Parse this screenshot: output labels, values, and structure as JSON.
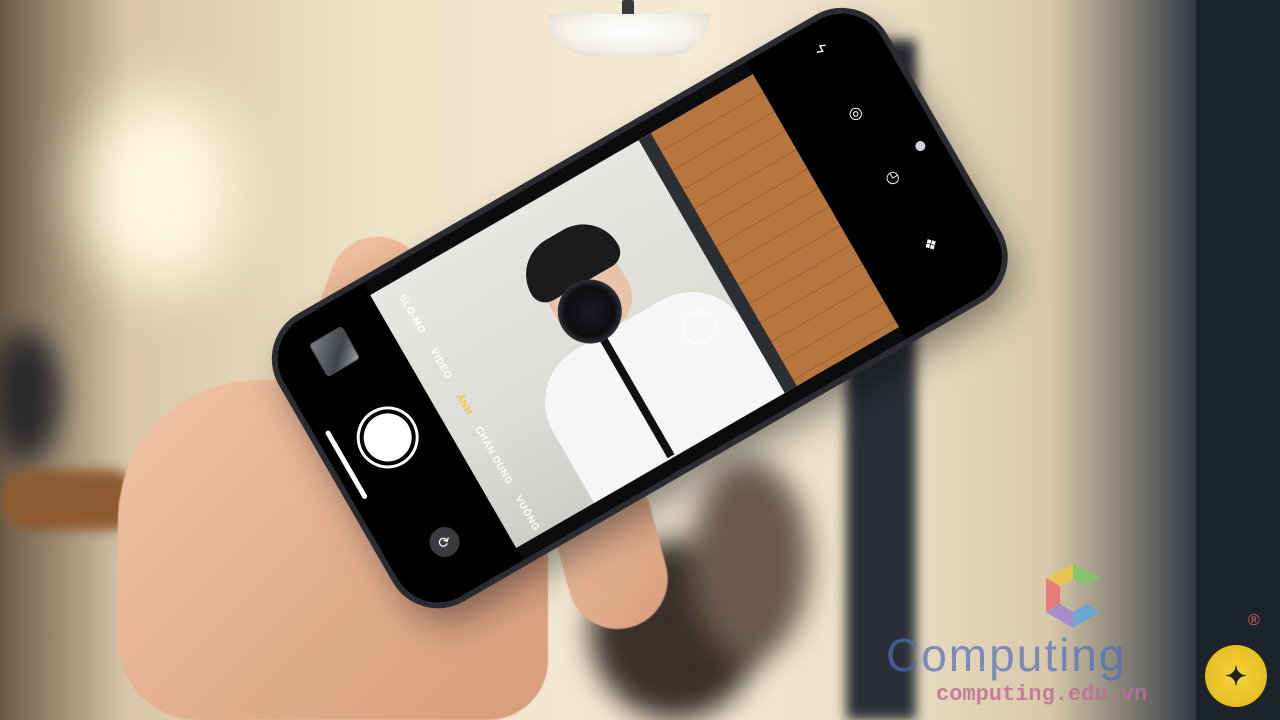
{
  "camera_app": {
    "modes": [
      {
        "label": "SLO-MO",
        "active": false
      },
      {
        "label": "VIDEO",
        "active": false
      },
      {
        "label": "ẢNH",
        "active": true
      },
      {
        "label": "CHÂN DUNG",
        "active": false
      },
      {
        "label": "VUÔNG",
        "active": false
      }
    ],
    "controls": {
      "flash_icon": "flash-icon",
      "live_photo_icon": "live-photo-icon",
      "timer_icon": "timer-icon",
      "filter_icon": "filter-icon",
      "shutter_icon": "shutter-button",
      "flip_icon": "camera-flip-icon",
      "thumbnail_icon": "gallery-thumbnail"
    },
    "accent_color": "#f5c542"
  },
  "watermark": {
    "title": "Computing",
    "url": "computing.edu.vn",
    "registered": "®"
  }
}
